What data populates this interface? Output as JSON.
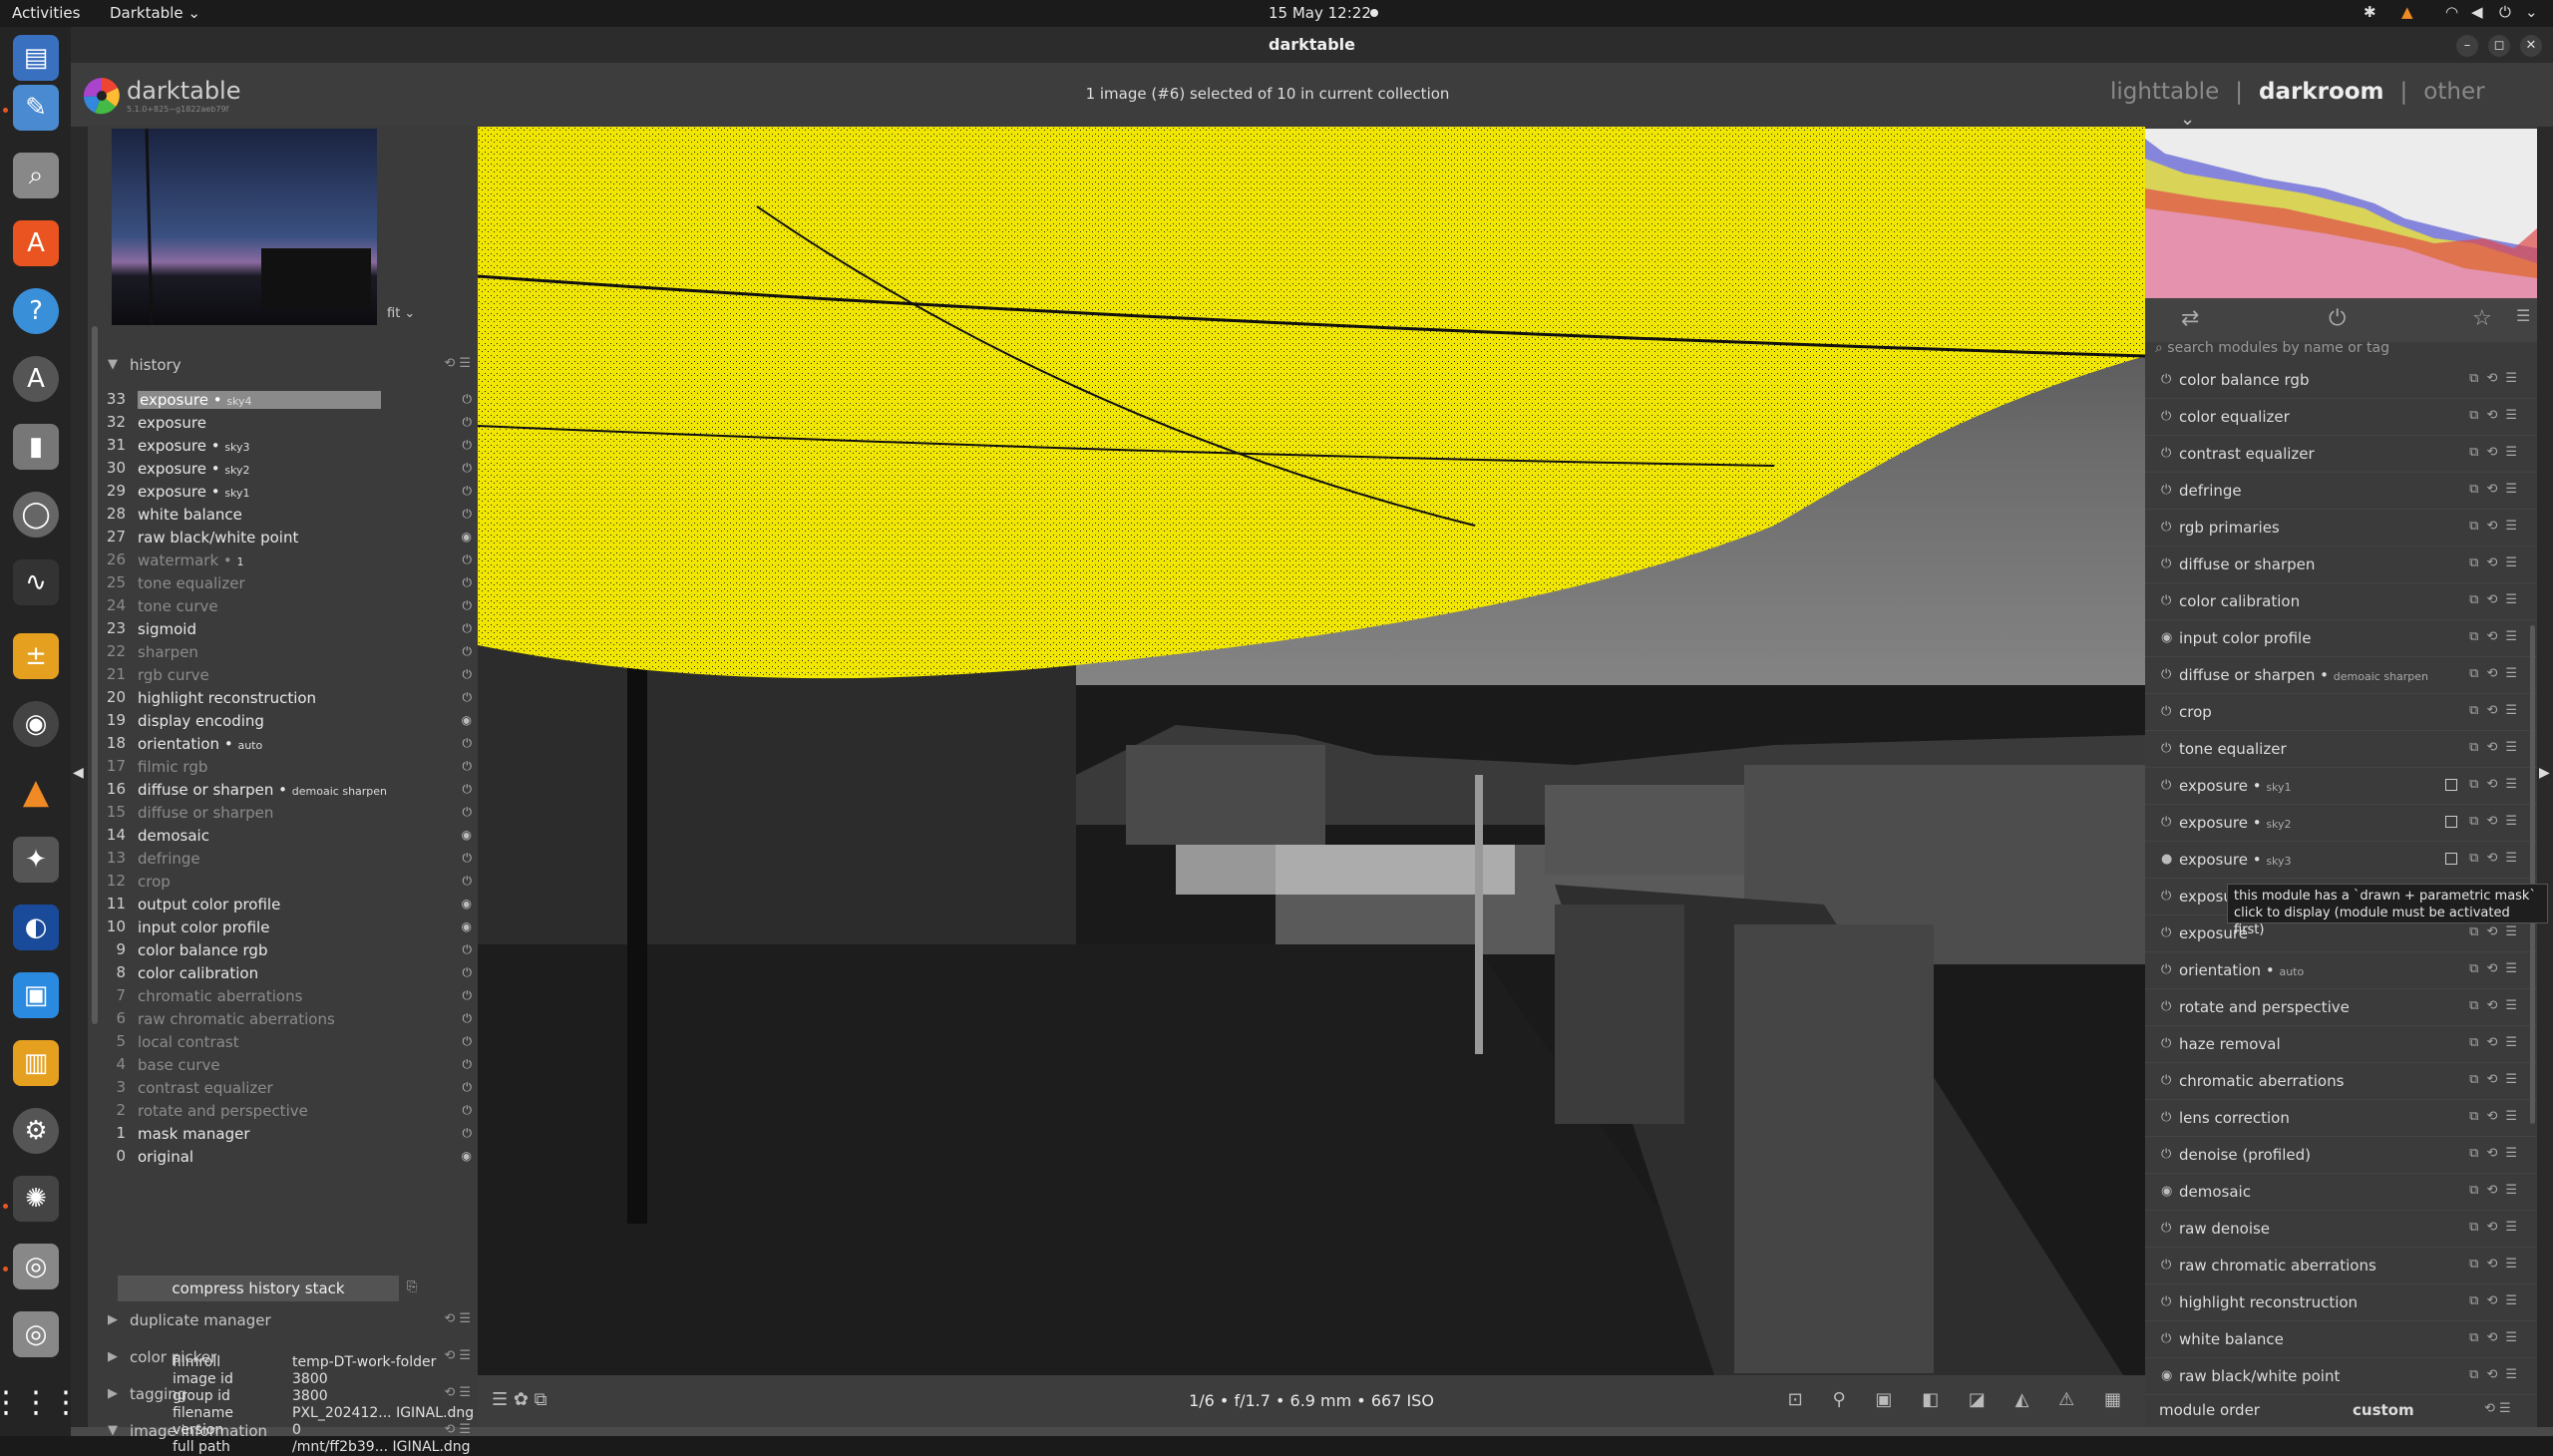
{
  "system": {
    "activities": "Activities",
    "app_menu": "Darktable ⌄",
    "clock": "15 May  12:22",
    "tray_icons": [
      "bluetooth-icon",
      "vlc-icon",
      "wifi-icon",
      "volume-icon",
      "power-icon",
      "chevron-down-icon"
    ]
  },
  "dock": {
    "apps": [
      "files-icon",
      "text-editor-icon",
      "search-icon",
      "software-center-icon",
      "help-icon",
      "update-icon",
      "usb-icon",
      "screenshot-icon",
      "system-monitor-icon",
      "calculator-icon",
      "disk-icon",
      "vlc-icon",
      "gimp-icon",
      "blender-icon",
      "cpu-icon",
      "archive-icon",
      "settings-icon",
      "darktable-icon",
      "disk2-icon",
      "disk3-icon",
      "app-grid-icon"
    ]
  },
  "window": {
    "title": "darktable",
    "buttons": {
      "minimize": "–",
      "maximize": "◻",
      "close": "✕"
    }
  },
  "header": {
    "app_name": "darktable",
    "version": "5.1.0+825~g1822aeb79f",
    "collection_status": "1 image (#6) selected of 10 in current collection",
    "views": {
      "lighttable": "lighttable",
      "darkroom": "darkroom",
      "other": "other",
      "sep": "|"
    }
  },
  "left": {
    "fit_label": "fit ⌄",
    "history_title": "history",
    "history": [
      {
        "num": "33",
        "name": "exposure",
        "sub": "sky4",
        "state": "sel"
      },
      {
        "num": "32",
        "name": "exposure",
        "sub": "",
        "state": "on"
      },
      {
        "num": "31",
        "name": "exposure",
        "sub": "sky3",
        "state": "on"
      },
      {
        "num": "30",
        "name": "exposure",
        "sub": "sky2",
        "state": "on"
      },
      {
        "num": "29",
        "name": "exposure",
        "sub": "sky1",
        "state": "on"
      },
      {
        "num": "28",
        "name": "white balance",
        "sub": "",
        "state": "on"
      },
      {
        "num": "27",
        "name": "raw black/white point",
        "sub": "",
        "state": "on"
      },
      {
        "num": "26",
        "name": "watermark",
        "sub": "1",
        "state": "off"
      },
      {
        "num": "25",
        "name": "tone equalizer",
        "sub": "",
        "state": "off"
      },
      {
        "num": "24",
        "name": "tone curve",
        "sub": "",
        "state": "off"
      },
      {
        "num": "23",
        "name": "sigmoid",
        "sub": "",
        "state": "on"
      },
      {
        "num": "22",
        "name": "sharpen",
        "sub": "",
        "state": "off"
      },
      {
        "num": "21",
        "name": "rgb curve",
        "sub": "",
        "state": "off"
      },
      {
        "num": "20",
        "name": "highlight reconstruction",
        "sub": "",
        "state": "on"
      },
      {
        "num": "19",
        "name": "display encoding",
        "sub": "",
        "state": "on"
      },
      {
        "num": "18",
        "name": "orientation",
        "sub": "auto",
        "state": "on"
      },
      {
        "num": "17",
        "name": "filmic rgb",
        "sub": "",
        "state": "off"
      },
      {
        "num": "16",
        "name": "diffuse or sharpen",
        "sub": "demoaic sharpen",
        "state": "on"
      },
      {
        "num": "15",
        "name": "diffuse or sharpen",
        "sub": "",
        "state": "off"
      },
      {
        "num": "14",
        "name": "demosaic",
        "sub": "",
        "state": "on"
      },
      {
        "num": "13",
        "name": "defringe",
        "sub": "",
        "state": "off"
      },
      {
        "num": "12",
        "name": "crop",
        "sub": "",
        "state": "off"
      },
      {
        "num": "11",
        "name": "output color profile",
        "sub": "",
        "state": "on"
      },
      {
        "num": "10",
        "name": "input color profile",
        "sub": "",
        "state": "on"
      },
      {
        "num": "9",
        "name": "color balance rgb",
        "sub": "",
        "state": "on"
      },
      {
        "num": "8",
        "name": "color calibration",
        "sub": "",
        "state": "on"
      },
      {
        "num": "7",
        "name": "chromatic aberrations",
        "sub": "",
        "state": "off"
      },
      {
        "num": "6",
        "name": "raw chromatic aberrations",
        "sub": "",
        "state": "off"
      },
      {
        "num": "5",
        "name": "local contrast",
        "sub": "",
        "state": "off"
      },
      {
        "num": "4",
        "name": "base curve",
        "sub": "",
        "state": "off"
      },
      {
        "num": "3",
        "name": "contrast equalizer",
        "sub": "",
        "state": "off"
      },
      {
        "num": "2",
        "name": "rotate and perspective",
        "sub": "",
        "state": "off"
      },
      {
        "num": "1",
        "name": "mask manager",
        "sub": "",
        "state": "on"
      },
      {
        "num": "0",
        "name": "original",
        "sub": "",
        "state": "on"
      }
    ],
    "compress_label": "compress history stack",
    "modules": {
      "duplicate": "duplicate manager",
      "color_picker": "color picker",
      "tagging": "tagging",
      "image_info": "image information"
    },
    "image_info": [
      {
        "k": "filmroll",
        "v": "temp-DT-work-folder"
      },
      {
        "k": "image id",
        "v": "3800"
      },
      {
        "k": "group id",
        "v": "3800"
      },
      {
        "k": "filename",
        "v": "PXL_202412... IGINAL.dng"
      },
      {
        "k": "version",
        "v": "0"
      },
      {
        "k": "full path",
        "v": "/mnt/ff2b39... IGINAL.dng"
      }
    ]
  },
  "center": {
    "exif": "1/6 • f/1.7 • 6.9 mm • 667 ISO",
    "mask_color": "#f0e600"
  },
  "right": {
    "search_placeholder": "search modules by name or tag",
    "modules": [
      {
        "name": "color balance rgb",
        "sub": "",
        "mask": false,
        "pw": "on"
      },
      {
        "name": "color equalizer",
        "sub": "",
        "mask": false,
        "pw": "on"
      },
      {
        "name": "contrast equalizer",
        "sub": "",
        "mask": false,
        "pw": "on"
      },
      {
        "name": "defringe",
        "sub": "",
        "mask": false,
        "pw": "on"
      },
      {
        "name": "rgb primaries",
        "sub": "",
        "mask": false,
        "pw": "on"
      },
      {
        "name": "diffuse or sharpen",
        "sub": "",
        "mask": false,
        "pw": "on"
      },
      {
        "name": "color calibration",
        "sub": "",
        "mask": false,
        "pw": "on"
      },
      {
        "name": "input color profile",
        "sub": "",
        "mask": false,
        "pw": "fixed"
      },
      {
        "name": "diffuse or sharpen",
        "sub": "demoaic sharpen",
        "mask": false,
        "pw": "on"
      },
      {
        "name": "crop",
        "sub": "",
        "mask": false,
        "pw": "on"
      },
      {
        "name": "tone equalizer",
        "sub": "",
        "mask": false,
        "pw": "on"
      },
      {
        "name": "exposure",
        "sub": "sky1",
        "mask": true,
        "pw": "on"
      },
      {
        "name": "exposure",
        "sub": "sky2",
        "mask": true,
        "pw": "on"
      },
      {
        "name": "exposure",
        "sub": "sky3",
        "mask": true,
        "pw": "active"
      },
      {
        "name": "exposure",
        "sub": "sky4",
        "mask": true,
        "pw": "on"
      },
      {
        "name": "exposure",
        "sub": "",
        "mask": false,
        "pw": "on"
      },
      {
        "name": "orientation",
        "sub": "auto",
        "mask": false,
        "pw": "on"
      },
      {
        "name": "rotate and perspective",
        "sub": "",
        "mask": false,
        "pw": "on"
      },
      {
        "name": "haze removal",
        "sub": "",
        "mask": false,
        "pw": "on"
      },
      {
        "name": "chromatic aberrations",
        "sub": "",
        "mask": false,
        "pw": "on"
      },
      {
        "name": "lens correction",
        "sub": "",
        "mask": false,
        "pw": "on"
      },
      {
        "name": "denoise (profiled)",
        "sub": "",
        "mask": false,
        "pw": "on"
      },
      {
        "name": "demosaic",
        "sub": "",
        "mask": false,
        "pw": "fixed"
      },
      {
        "name": "raw denoise",
        "sub": "",
        "mask": false,
        "pw": "on"
      },
      {
        "name": "raw chromatic aberrations",
        "sub": "",
        "mask": false,
        "pw": "on"
      },
      {
        "name": "highlight reconstruction",
        "sub": "",
        "mask": false,
        "pw": "on"
      },
      {
        "name": "white balance",
        "sub": "",
        "mask": false,
        "pw": "on"
      },
      {
        "name": "raw black/white point",
        "sub": "",
        "mask": false,
        "pw": "fixed"
      }
    ],
    "tooltip_line1": "this module has a `drawn + parametric mask`",
    "tooltip_line2": "click to display (module must be activated first)",
    "module_order_label": "module order",
    "module_order_value": "custom"
  }
}
